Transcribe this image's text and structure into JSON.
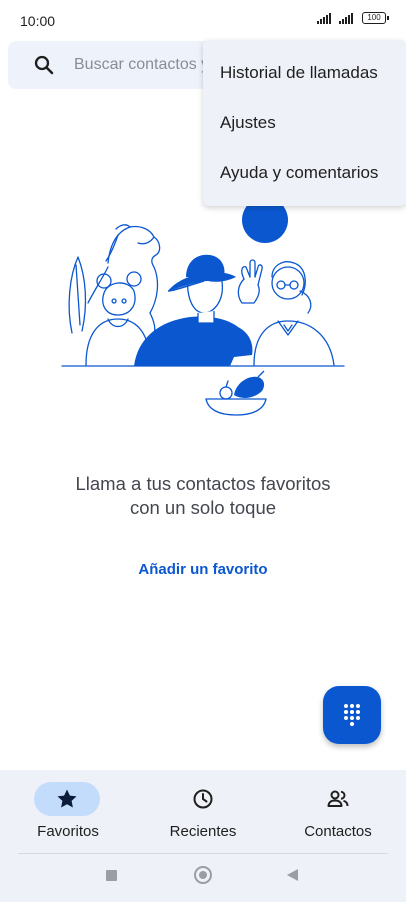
{
  "status_bar": {
    "time": "10:00",
    "battery": "100"
  },
  "search": {
    "placeholder": "Buscar contactos y"
  },
  "overflow_menu": {
    "items": [
      {
        "label": "Historial de llamadas"
      },
      {
        "label": "Ajustes"
      },
      {
        "label": "Ayuda y comentarios"
      }
    ]
  },
  "empty_state": {
    "title": "Llama a tus contactos favoritos con un solo toque",
    "action_label": "Añadir un favorito"
  },
  "fab": {
    "icon": "dialpad-icon"
  },
  "bottom_nav": {
    "items": [
      {
        "label": "Favoritos",
        "icon": "star-icon",
        "active": true
      },
      {
        "label": "Recientes",
        "icon": "clock-icon",
        "active": false
      },
      {
        "label": "Contactos",
        "icon": "people-icon",
        "active": false
      }
    ]
  },
  "colors": {
    "accent": "#0b57d0",
    "active_pill": "#c4dcfc",
    "surface": "#eef1f8"
  }
}
